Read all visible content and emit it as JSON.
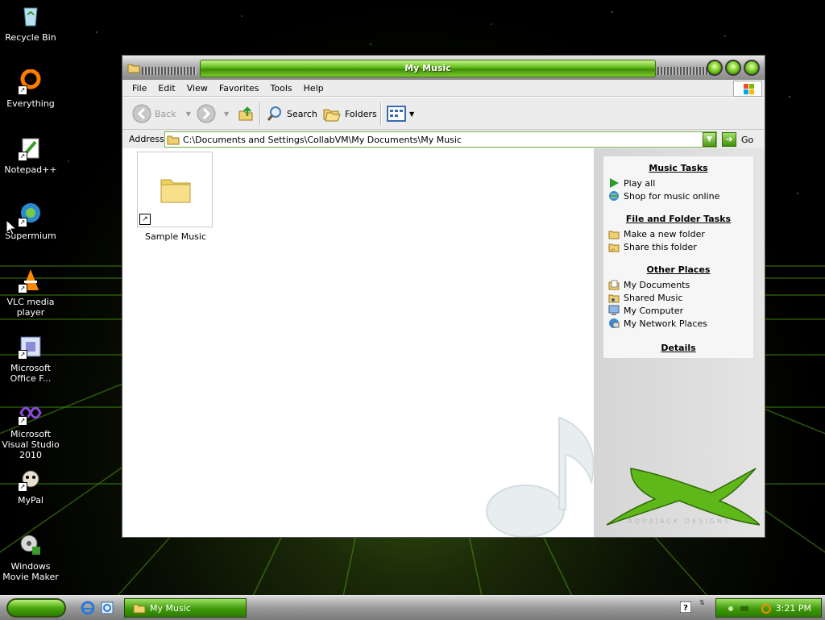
{
  "desktop": {
    "icons": [
      {
        "label": "Recycle Bin",
        "icon": "recycle-bin-icon"
      },
      {
        "label": "Everything",
        "icon": "everything-icon"
      },
      {
        "label": "Notepad++",
        "icon": "notepad-plus-plus-icon"
      },
      {
        "label": "Supermium",
        "icon": "supermium-icon"
      },
      {
        "label": "VLC media player",
        "icon": "vlc-icon"
      },
      {
        "label": "Microsoft Office F...",
        "icon": "office-icon"
      },
      {
        "label": "Microsoft Visual Studio 2010",
        "icon": "visual-studio-icon"
      },
      {
        "label": "MyPal",
        "icon": "mypal-icon"
      },
      {
        "label": "Windows Movie Maker",
        "icon": "movie-maker-icon"
      }
    ]
  },
  "window": {
    "title": "My Music",
    "menu": [
      "File",
      "Edit",
      "View",
      "Favorites",
      "Tools",
      "Help"
    ],
    "toolbar": {
      "back": "Back",
      "search": "Search",
      "folders": "Folders"
    },
    "address": {
      "label": "Address",
      "value": "C:\\Documents and Settings\\CollabVM\\My Documents\\My Music",
      "go": "Go"
    },
    "items": [
      {
        "label": "Sample Music",
        "icon": "folder-icon",
        "shortcut": true
      }
    ],
    "tasks": {
      "music_tasks": {
        "title": "Music Tasks",
        "links": [
          {
            "label": "Play all",
            "icon": "play-icon"
          },
          {
            "label": "Shop for music online",
            "icon": "globe-icon"
          }
        ]
      },
      "file_folder_tasks": {
        "title": "File and Folder Tasks",
        "links": [
          {
            "label": "Make a new folder",
            "icon": "new-folder-icon"
          },
          {
            "label": "Share this folder",
            "icon": "share-folder-icon"
          }
        ]
      },
      "other_places": {
        "title": "Other Places",
        "links": [
          {
            "label": "My Documents",
            "icon": "documents-icon"
          },
          {
            "label": "Shared Music",
            "icon": "shared-music-icon"
          },
          {
            "label": "My Computer",
            "icon": "computer-icon"
          },
          {
            "label": "My Network Places",
            "icon": "network-icon"
          }
        ]
      },
      "details": {
        "title": "Details"
      }
    },
    "watermark": "AQUAJACK DESIGNS"
  },
  "taskbar": {
    "active_task": "My Music",
    "clock": "3:21 PM"
  },
  "colors": {
    "accent_green": "#5fb81a",
    "dark_green": "#2e7a04",
    "chrome_gray": "#c9c9c9"
  }
}
